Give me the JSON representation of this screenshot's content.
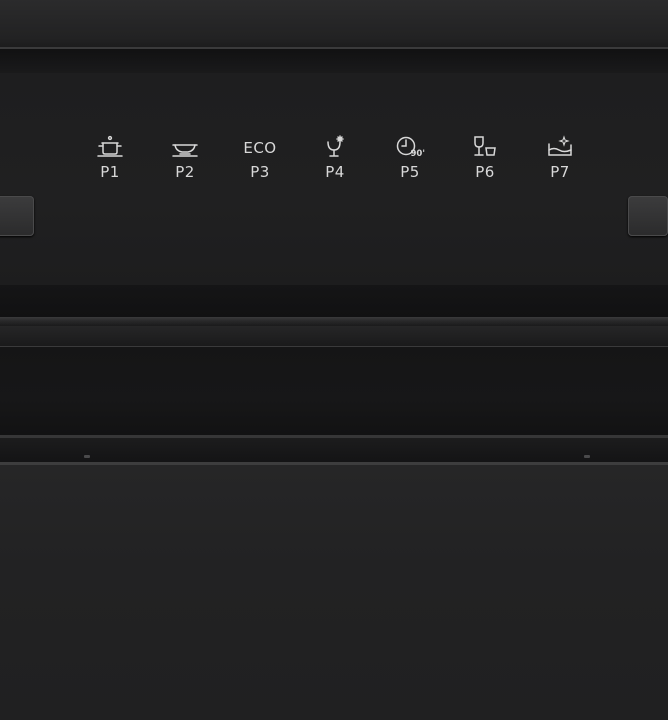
{
  "control_panel": {
    "programs": [
      {
        "id": "p1",
        "label": "P1",
        "icon": "pot-icon"
      },
      {
        "id": "p2",
        "label": "P2",
        "icon": "plate-icon"
      },
      {
        "id": "p3",
        "label": "P3",
        "icon_text": "ECO"
      },
      {
        "id": "p4",
        "label": "P4",
        "icon": "glass-sparkle-icon"
      },
      {
        "id": "p5",
        "label": "P5",
        "icon": "clock-90-icon",
        "icon_text": "90'"
      },
      {
        "id": "p6",
        "label": "P6",
        "icon": "wine-glass-cup-icon"
      },
      {
        "id": "p7",
        "label": "P7",
        "icon": "tub-sparkle-icon"
      }
    ]
  },
  "colors": {
    "appliance_body": "#1f1f20",
    "panel_text": "#d8d8d8",
    "trim": "#3a3a3b"
  }
}
